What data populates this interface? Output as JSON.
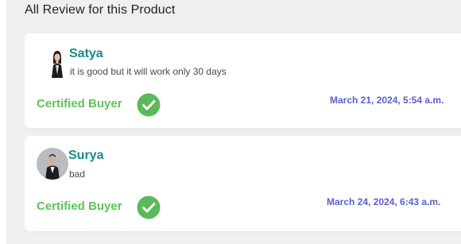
{
  "section": {
    "title": "All Review for this Product"
  },
  "reviews": [
    {
      "name": "Satya",
      "text": "it is good but it will work only 30 days",
      "badge": "Certified Buyer",
      "date": "March 21, 2024, 5:54 a.m."
    },
    {
      "name": "Surya",
      "text": "bad",
      "badge": "Certified Buyer",
      "date": "March 24, 2024, 6:43 a.m."
    }
  ],
  "colors": {
    "name": "#1a8a8a",
    "certified": "#5cc45a",
    "date": "#5a5fcf",
    "panel_bg": "#efefef"
  },
  "icons": {
    "verified": "check-circle-icon"
  }
}
